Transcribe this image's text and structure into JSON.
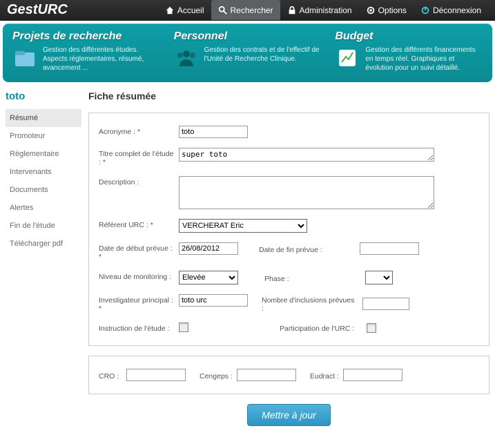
{
  "brand": "GestURC",
  "nav": {
    "accueil": "Accueil",
    "rechercher": "Rechercher",
    "administration": "Administration",
    "options": "Options",
    "deconnexion": "Déconnexion"
  },
  "banner": {
    "projets": {
      "title": "Projets de recherche",
      "desc": "Gestion des différentes études. Aspects réglementaires, résumé, avancement ..."
    },
    "personnel": {
      "title": "Personnel",
      "desc": "Gestion des contrats et de l'effectif de l'Unité de Recherche Clinique."
    },
    "budget": {
      "title": "Budget",
      "desc": "Gestion des différents financements en temps réel. Graphiques et évolution pour un suivi détaillé."
    }
  },
  "sidebar": {
    "title": "toto",
    "items": [
      "Résumé",
      "Promoteur",
      "Règlementaire",
      "Intervenants",
      "Documents",
      "Alertes",
      "Fin de l'étude",
      "Télécharger pdf"
    ]
  },
  "page": {
    "title": "Fiche résumée"
  },
  "form": {
    "labels": {
      "acronyme": "Acronyme : *",
      "titre": "Titre complet de l'étude : *",
      "description": "Description :",
      "referent": "Référent URC : *",
      "date_debut": "Date de début prévue : *",
      "date_fin": "Date de fin prévue :",
      "monitoring": "Niveau de monitoring :",
      "phase": "Phase :",
      "investigateur": "Investigateur principal : *",
      "inclusions": "Nombre d'inclusions prévues :",
      "instruction": "Instruction de l'étude :",
      "participation": "Participation de l'URC :",
      "cro": "CRO :",
      "cengeps": "Cengeps :",
      "eudract": "Eudract :"
    },
    "values": {
      "acronyme": "toto",
      "titre": "super toto",
      "description": "",
      "referent": "VERCHERAT Eric",
      "date_debut": "26/08/2012",
      "date_fin": "",
      "monitoring": "Elevée",
      "phase": "",
      "investigateur": "toto urc",
      "inclusions": "",
      "cro": "",
      "cengeps": "",
      "eudract": ""
    },
    "submit": "Mettre à jour"
  }
}
